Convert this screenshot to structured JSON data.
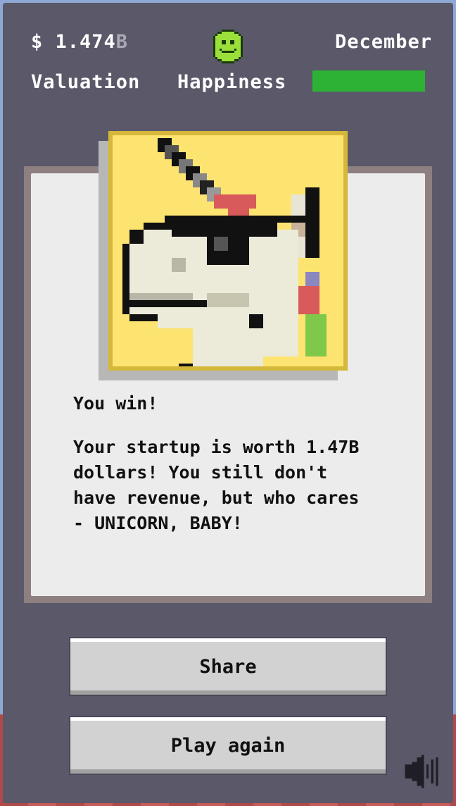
{
  "hud": {
    "valuation_value": "$ 1.474",
    "valuation_value_suffix": "B",
    "valuation_label": "Valuation",
    "happiness_label": "Happiness",
    "happiness_icon": "smiley-face-icon",
    "happiness_level": 1.0,
    "month": "December"
  },
  "result": {
    "title": "You win!",
    "body": "Your startup is worth 1.47B\ndollars! You still don't\nhave revenue, but who cares\n- UNICORN, BABY!",
    "portrait_icon": "unicorn-with-sunglasses-icon"
  },
  "actions": {
    "share_label": "Share",
    "play_again_label": "Play again",
    "sound_icon": "speaker-icon"
  },
  "colors": {
    "frame": "#5a5869",
    "happiness_bar": "#2db236",
    "card": "#ececec",
    "portrait_bg": "#fde470"
  }
}
